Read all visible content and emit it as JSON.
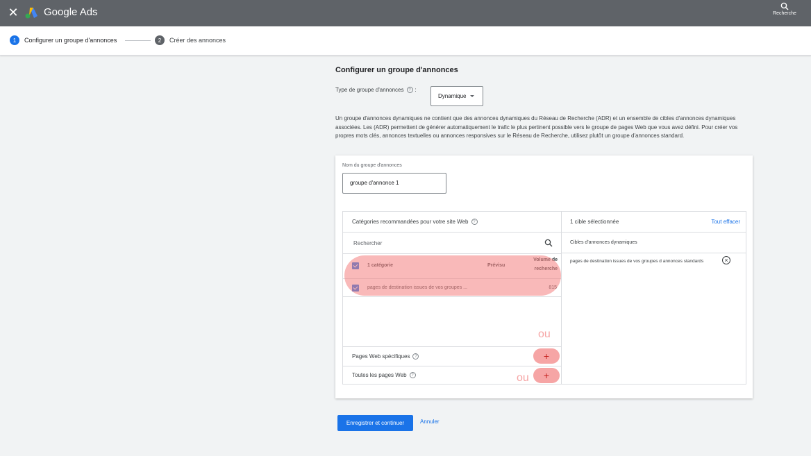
{
  "topbar": {
    "close_symbol": "✕",
    "brand": "Google Ads",
    "search_label": "Recherche"
  },
  "stepper": {
    "steps": [
      {
        "num": "1",
        "label": "Configurer un groupe d'annonces"
      },
      {
        "num": "2",
        "label": "Créer des annonces"
      }
    ]
  },
  "main": {
    "title": "Configurer un groupe d'annonces",
    "type_label": "Type de groupe d'annonces",
    "type_colon": ":",
    "type_value": "Dynamique",
    "description": "Un groupe d'annonces dynamiques ne contient que des annonces dynamiques du Réseau de Recherche (ADR) et un ensemble de cibles d'annonces dynamiques associées. Les (ADR) permettent de générer automatiquement le trafic le plus pertinent possible vers le groupe de pages Web que vous avez défini. Pour créer vos propres mots clés, annonces textuelles ou annonces responsives sur le Réseau de Recherche, utilisez plutôt un groupe d'annonces standard."
  },
  "card": {
    "name_label": "Nom du groupe d'annonces",
    "name_value": "groupe d'annonce 1",
    "left": {
      "header": "Catégories recommandées pour votre site Web",
      "search_placeholder": "Rechercher",
      "cat_header": {
        "label": "1 catégorie",
        "preview": "Prévisu",
        "volume_line1": "Volume de",
        "volume_line2": "recherche"
      },
      "cat_row": {
        "label": "pages de destination issues de vos groupes ...",
        "volume": "815"
      },
      "ou_1": "ou",
      "pages_label": "Pages Web spécifiques",
      "all_label": "Toutes les pages Web",
      "ou_2": "ou",
      "plus": "+"
    },
    "right": {
      "selected": "1 cible sélectionnée",
      "clear": "Tout effacer",
      "sub_header": "Cibles d'annonces dynamiques",
      "item": "pages de destination issues de vos groupes d annonces standards",
      "remove": "×"
    }
  },
  "footer": {
    "save": "Enregistrer et continuer",
    "cancel": "Annuler"
  },
  "colors": {
    "topbar": "#5f6368",
    "accent": "#1a73e8",
    "highlight": "#f48080"
  },
  "icons": [
    "close-icon",
    "google-ads-logo",
    "search-icon",
    "help-icon",
    "caret-down-icon",
    "checkbox-icon",
    "add-icon",
    "remove-circle-icon"
  ]
}
